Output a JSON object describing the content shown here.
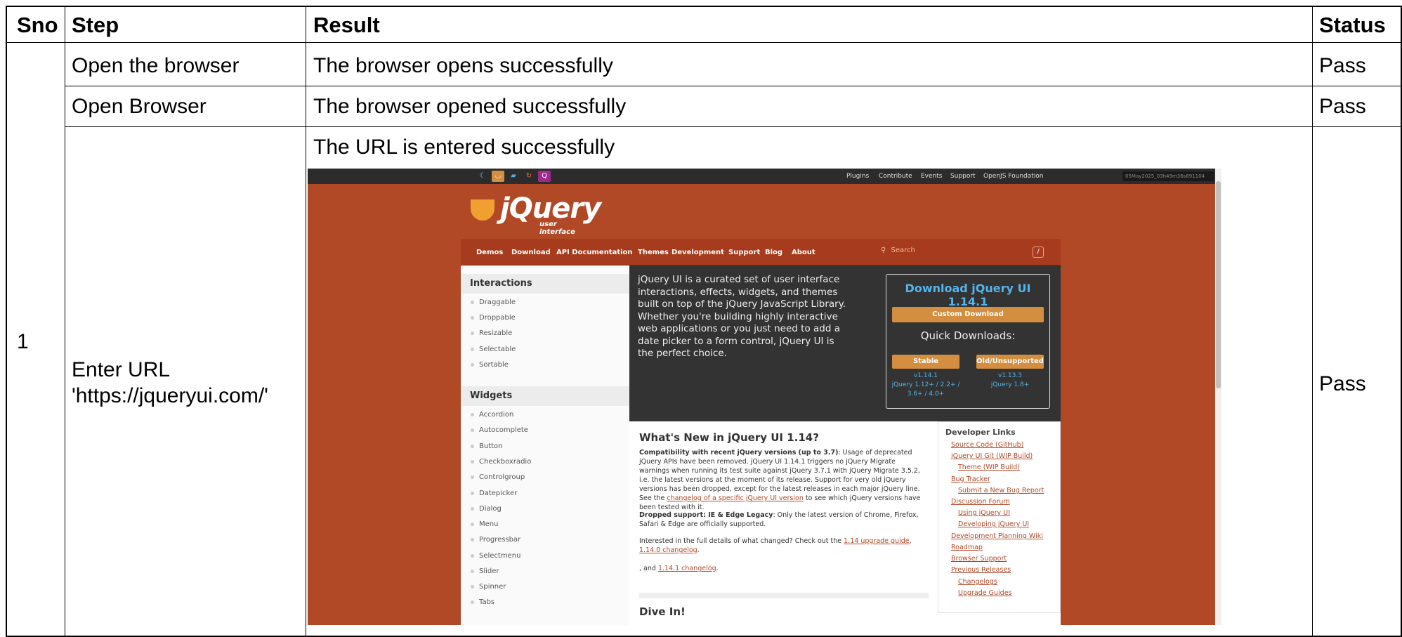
{
  "table": {
    "headers": {
      "sno": "Sno",
      "step": "Step",
      "result": "Result",
      "status": "Status"
    },
    "sno": "1",
    "rows": [
      {
        "step": "Open the browser",
        "result": "The browser opens successfully",
        "status": "Pass"
      },
      {
        "step": "Open Browser",
        "result": "The browser opened successfully",
        "status": "Pass"
      },
      {
        "step_line1": "Enter URL",
        "step_line2": "'https://jqueryui.com/'",
        "result": "The URL is entered successfully",
        "status": "Pass"
      }
    ]
  },
  "screenshot": {
    "top_links": [
      "Plugins",
      "Contribute",
      "Events",
      "Support",
      "OpenJS Foundation"
    ],
    "timestamp": "05May2025_03h49m36s891104",
    "logo": {
      "text": "jQuery",
      "sub": "user interface"
    },
    "nav": [
      "Demos",
      "Download",
      "API Documentation",
      "Themes",
      "Development",
      "Support",
      "Blog",
      "About"
    ],
    "search_placeholder": "Search",
    "search_shortcut": "/",
    "sidebar": {
      "interactions_title": "Interactions",
      "interactions": [
        "Draggable",
        "Droppable",
        "Resizable",
        "Selectable",
        "Sortable"
      ],
      "widgets_title": "Widgets",
      "widgets": [
        "Accordion",
        "Autocomplete",
        "Button",
        "Checkboxradio",
        "Controlgroup",
        "Datepicker",
        "Dialog",
        "Menu",
        "Progressbar",
        "Selectmenu",
        "Slider",
        "Spinner",
        "Tabs"
      ]
    },
    "intro": "jQuery UI is a curated set of user interface interactions, effects, widgets, and themes built on top of the jQuery JavaScript Library. Whether you're building highly interactive web applications or you just need to add a date picker to a form control, jQuery UI is the perfect choice.",
    "download": {
      "title": "Download jQuery UI 1.14.1",
      "custom": "Custom Download",
      "quick": "Quick Downloads:",
      "stable": "Stable",
      "stable_version": "v1.14.1",
      "stable_compat_1": "jQuery 1.12+ / 2.2+ /",
      "stable_compat_2": "3.6+ / 4.0+",
      "old": "Old/Unsupported",
      "old_version": "v1.13.3",
      "old_compat": "jQuery 1.8+"
    },
    "whats_new": {
      "title": "What's New in jQuery UI 1.14?",
      "p1_bold": "Compatibility with recent jQuery versions (up to 3.7)",
      "p1_text": ": Usage of deprecated jQuery APIs have been removed. jQuery UI 1.14.1 triggers no jQuery Migrate warnings when running its test suite against jQuery 3.7.1 with jQuery Migrate 3.5.2, i.e. the latest versions at the moment of its release. Support for very old jQuery versions has been dropped, except for the latest releases in each major jQuery line. See the ",
      "p1_link": "changelog of a specific jQuery UI version",
      "p1_end": " to see which jQuery versions have been tested with it.",
      "p2_bold": "Dropped support: IE & Edge Legacy",
      "p2_text": ": Only the latest version of Chrome, Firefox, Safari & Edge are officially supported.",
      "p3_text": "Interested in the full details of what changed? Check out the ",
      "p3_link1": "1.14 upgrade guide",
      "p3_sep": ", ",
      "p3_link2": "1.14.0 changelog",
      "p3_end": ".",
      "p4_text": ", and ",
      "p4_link": "1.14.1 changelog",
      "p4_end": ".",
      "dive_in": "Dive In!"
    },
    "dev_links": {
      "title": "Developer Links",
      "items": [
        "Source Code (GitHub)",
        "jQuery UI Git (WIP Build)",
        "Theme (WIP Build)",
        "Bug Tracker",
        "Submit a New Bug Report",
        "Discussion Forum",
        "Using jQuery UI",
        "Developing jQuery UI",
        "Development Planning Wiki",
        "Roadmap",
        "Browser Support",
        "Previous Releases",
        "Changelogs",
        "Upgrade Guides"
      ]
    }
  }
}
